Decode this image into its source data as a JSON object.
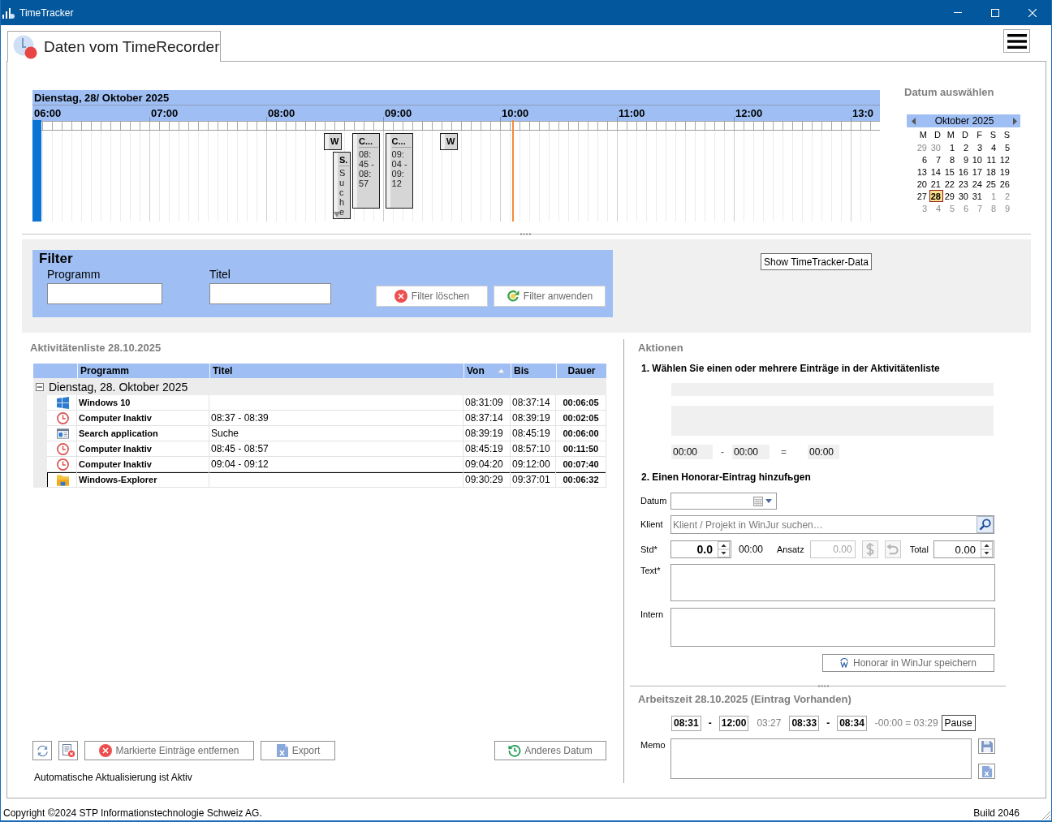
{
  "window": {
    "title": "TimeTracker"
  },
  "tab": {
    "label": "Daten vom TimeRecorder",
    "selected": true
  },
  "timeline": {
    "date": "Dienstag, 28/ Oktober 2025",
    "hours": [
      "06:00",
      "07:00",
      "08:00",
      "09:00",
      "10:00",
      "11:00",
      "12:00",
      "13:0"
    ],
    "now_marker": {
      "level": 0.566
    }
  },
  "calendar": {
    "heading": "Datum auswählen",
    "month": "Oktober 2025",
    "weekdays": [
      "M",
      "D",
      "M",
      "D",
      "F",
      "S",
      "S"
    ],
    "weeks": [
      [
        {
          "day": "29",
          "muted": true,
          "selected": false
        },
        {
          "day": "30",
          "muted": true,
          "selected": false
        },
        {
          "day": "1",
          "muted": false,
          "selected": false
        },
        {
          "day": "2",
          "muted": false,
          "selected": false
        },
        {
          "day": "3",
          "muted": false,
          "selected": false
        },
        {
          "day": "4",
          "muted": false,
          "selected": false
        },
        {
          "day": "5",
          "muted": false,
          "selected": false
        }
      ],
      [
        {
          "day": "6",
          "muted": false,
          "selected": false
        },
        {
          "day": "7",
          "muted": false,
          "selected": false
        },
        {
          "day": "8",
          "muted": false,
          "selected": false
        },
        {
          "day": "9",
          "muted": false,
          "selected": false
        },
        {
          "day": "10",
          "muted": false,
          "selected": false
        },
        {
          "day": "11",
          "muted": false,
          "selected": false
        },
        {
          "day": "12",
          "muted": false,
          "selected": false
        }
      ],
      [
        {
          "day": "13",
          "muted": false,
          "selected": false
        },
        {
          "day": "14",
          "muted": false,
          "selected": false
        },
        {
          "day": "15",
          "muted": false,
          "selected": false
        },
        {
          "day": "16",
          "muted": false,
          "selected": false
        },
        {
          "day": "17",
          "muted": false,
          "selected": false
        },
        {
          "day": "18",
          "muted": false,
          "selected": false
        },
        {
          "day": "19",
          "muted": false,
          "selected": false
        }
      ],
      [
        {
          "day": "20",
          "muted": false,
          "selected": false
        },
        {
          "day": "21",
          "muted": false,
          "selected": false
        },
        {
          "day": "22",
          "muted": false,
          "selected": false
        },
        {
          "day": "23",
          "muted": false,
          "selected": false
        },
        {
          "day": "24",
          "muted": false,
          "selected": false
        },
        {
          "day": "25",
          "muted": false,
          "selected": false
        },
        {
          "day": "26",
          "muted": false,
          "selected": false
        }
      ],
      [
        {
          "day": "27",
          "muted": false,
          "selected": false
        },
        {
          "day": "28",
          "muted": false,
          "selected": true
        },
        {
          "day": "29",
          "muted": false,
          "selected": false
        },
        {
          "day": "30",
          "muted": false,
          "selected": false
        },
        {
          "day": "31",
          "muted": false,
          "selected": false
        },
        {
          "day": "1",
          "muted": true,
          "selected": false
        },
        {
          "day": "2",
          "muted": true,
          "selected": false
        }
      ],
      [
        {
          "day": "3",
          "muted": true,
          "selected": false
        },
        {
          "day": "4",
          "muted": true,
          "selected": false
        },
        {
          "day": "5",
          "muted": true,
          "selected": false
        },
        {
          "day": "6",
          "muted": true,
          "selected": false
        },
        {
          "day": "7",
          "muted": true,
          "selected": false
        },
        {
          "day": "8",
          "muted": true,
          "selected": false
        },
        {
          "day": "9",
          "muted": true,
          "selected": false
        }
      ]
    ]
  },
  "filter": {
    "title": "Filter",
    "fields": [
      {
        "label": "Programm"
      },
      {
        "label": "Titel"
      }
    ],
    "buttons": [
      {
        "kind": "clear",
        "label": "Filter löschen"
      },
      {
        "kind": "apply",
        "label": "Filter anwenden"
      }
    ]
  },
  "show_button": {
    "label": "Show TimeTracker-Data"
  },
  "activities": {
    "title": "Aktivitätenliste 28.10.2025",
    "columns": [
      {
        "label": "Programm",
        "sorted": false
      },
      {
        "label": "Titel",
        "sorted": false
      },
      {
        "label": "Von",
        "sorted": true
      },
      {
        "label": "Bis",
        "sorted": false
      },
      {
        "label": "Dauer",
        "sorted": false
      }
    ],
    "group": {
      "label": "Dienstag, 28. Oktober 2025",
      "expanded": true
    },
    "rows": [
      {
        "kind": "windows",
        "program": "Windows 10",
        "von": "08:31:09",
        "bis": "08:37:14",
        "dauer": "00:06:05",
        "selected": false,
        "timeline": {
          "title": "W",
          "kind": "compact",
          "overflow": false
        }
      },
      {
        "kind": "clock",
        "program": "Computer Inaktiv",
        "title": "08:37 - 08:39",
        "von": "08:37:14",
        "bis": "08:39:19",
        "dauer": "00:02:05",
        "selected": false
      },
      {
        "kind": "window",
        "program": "Search application",
        "title": "Suche",
        "von": "08:39:19",
        "bis": "08:45:19",
        "dauer": "00:06:00",
        "selected": false,
        "timeline": {
          "title": "S.",
          "text": "Suche",
          "kind": "compact",
          "overflow": true
        }
      },
      {
        "kind": "clock",
        "program": "Computer Inaktiv",
        "title": "08:45 - 08:57",
        "von": "08:45:19",
        "bis": "08:57:10",
        "dauer": "00:11:50",
        "selected": false,
        "timeline": {
          "title": "C...",
          "text": "08:45 - 08:57",
          "kind": "detail",
          "overflow": false
        }
      },
      {
        "kind": "clock",
        "program": "Computer Inaktiv",
        "title": "09:04 - 09:12",
        "von": "09:04:20",
        "bis": "09:12:00",
        "dauer": "00:07:40",
        "selected": false,
        "timeline": {
          "title": "C...",
          "text": "09:04 - 09:12",
          "kind": "detail",
          "overflow": false
        }
      },
      {
        "kind": "folder",
        "program": "Windows-Explorer",
        "von": "09:30:29",
        "bis": "09:37:01",
        "dauer": "00:06:32",
        "selected": true,
        "timeline": {
          "title": "W",
          "kind": "compact",
          "overflow": false
        }
      }
    ]
  },
  "list_buttons": [
    {
      "kind": "refresh"
    },
    {
      "kind": "delete-list"
    },
    {
      "kind": "remove",
      "label": "Markierte Einträge entfernen"
    },
    {
      "kind": "export",
      "label": "Export"
    }
  ],
  "other_date_button": {
    "label": "Anderes Datum"
  },
  "auto_update": "Automatische Aktualisierung ist Aktiv",
  "actions": {
    "title": "Aktionen",
    "step1": "1. Wählen Sie einen oder mehrere Einträge in der Aktivitätenliste",
    "from": "00:00",
    "dash": "-",
    "to": "00:00",
    "equals": "=",
    "total": "00:00"
  },
  "honorar": {
    "title": "2. Einen Honorar-Eintrag hinzufьgen",
    "datum_label": "Datum",
    "klient_label": "Klient",
    "klient_placeholder": "Klient / Projekt in WinJur suchen…",
    "std_label": "Std*",
    "std_value": "0.0",
    "std_time": "00:00",
    "ansatz_label": "Ansatz",
    "ansatz_value": "0.00",
    "ansatz_disabled": true,
    "tools": [
      {
        "kind": "dollar",
        "disabled": true
      },
      {
        "kind": "undo",
        "disabled": true
      }
    ],
    "total_label": "Total",
    "total_value": "0.00",
    "text_label": "Text*",
    "intern_label": "Intern",
    "save_button": "Honorar in WinJur speichern"
  },
  "arbeitszeit": {
    "title": "Arbeitszeit 28.10.2025 (Eintrag Vorhanden)",
    "blocks": [
      {
        "from": "08:31",
        "dash": "-",
        "to": "12:00",
        "result": "03:27"
      },
      {
        "from": "08:33",
        "dash": "-",
        "to": "08:34",
        "result": "-00:00 = 03:29"
      }
    ],
    "pause_button": "Pause",
    "memo_label": "Memo"
  },
  "footer": {
    "copyright": "Copyright ©2024 STP Informationstechnologie Schweiz AG.",
    "build": "Build 2046"
  }
}
